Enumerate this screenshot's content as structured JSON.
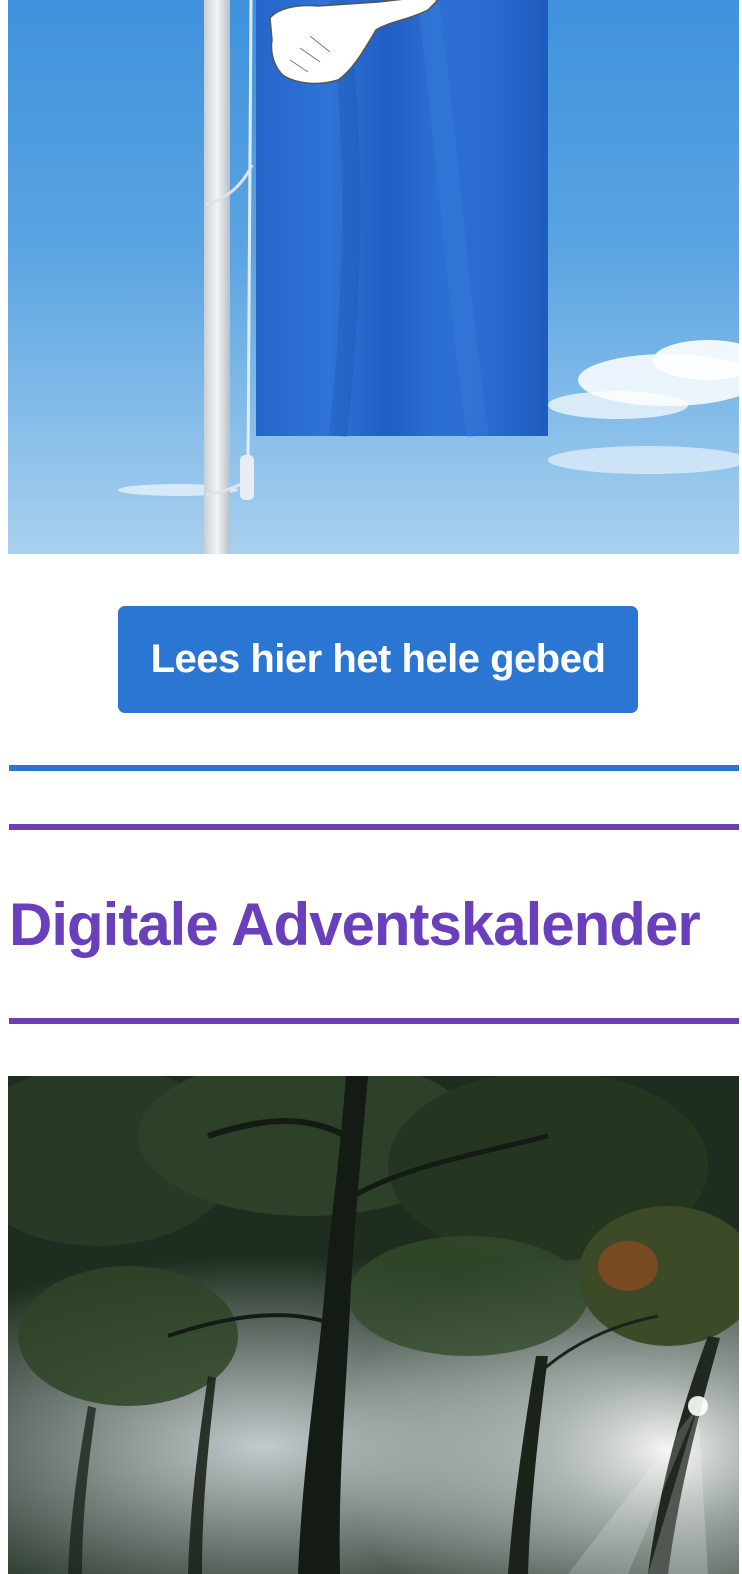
{
  "banner": {
    "image_description_icon": "flag-banner-image",
    "flag_color": "#2a6fcf",
    "sky_color": "#4a9be0"
  },
  "cta": {
    "label": "Lees hier het hele gebed",
    "color": "#2a76d2"
  },
  "dividers": {
    "blue": "#2a76d2",
    "purple": "#6b3fb3"
  },
  "advent": {
    "heading": "Digitale Adventskalender",
    "heading_color": "#6a3fbb",
    "image_icon": "forest-image"
  }
}
